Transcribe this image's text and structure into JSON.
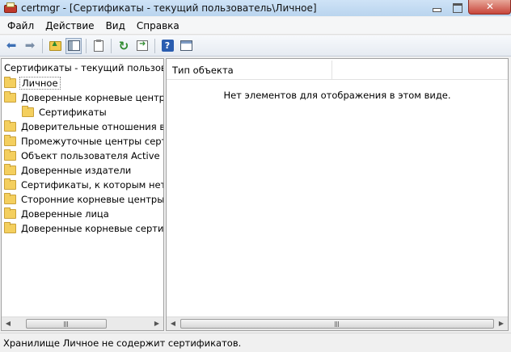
{
  "window": {
    "title": "certmgr - [Сертификаты - текущий пользователь\\Личное]"
  },
  "menu": [
    {
      "label": "Файл"
    },
    {
      "label": "Действие"
    },
    {
      "label": "Вид"
    },
    {
      "label": "Справка"
    }
  ],
  "toolbar": {
    "icons": [
      "back-arrow-icon",
      "forward-arrow-icon",
      "up-folder-icon",
      "show-hide-tree-icon",
      "clipboard-icon",
      "refresh-icon",
      "export-list-icon",
      "help-icon",
      "properties-icon"
    ]
  },
  "tree": {
    "root_label": "Сертификаты - текущий пользователь",
    "items": [
      {
        "label": "Личное",
        "selected": true,
        "child": false
      },
      {
        "label": "Доверенные корневые центры сертификации",
        "selected": false,
        "child": false
      },
      {
        "label": "Сертификаты",
        "selected": false,
        "child": true
      },
      {
        "label": "Доверительные отношения в предприятии",
        "selected": false,
        "child": false
      },
      {
        "label": "Промежуточные центры сертификации",
        "selected": false,
        "child": false
      },
      {
        "label": "Объект пользователя Active Directory",
        "selected": false,
        "child": false
      },
      {
        "label": "Доверенные издатели",
        "selected": false,
        "child": false
      },
      {
        "label": "Сертификаты, к которым нет доверия",
        "selected": false,
        "child": false
      },
      {
        "label": "Сторонние корневые центры сертификации",
        "selected": false,
        "child": false
      },
      {
        "label": "Доверенные лица",
        "selected": false,
        "child": false
      },
      {
        "label": "Доверенные корневые сертификаты смарт-карты",
        "selected": false,
        "child": false
      }
    ]
  },
  "list": {
    "column_header": "Тип объекта",
    "empty_message": "Нет элементов для отображения в этом виде."
  },
  "status": {
    "text": "Хранилище Личное не содержит сертификатов."
  },
  "colors": {
    "title_bar": "#b9d4ee",
    "close_button": "#c7453a",
    "folder": "#f4cf5e"
  }
}
